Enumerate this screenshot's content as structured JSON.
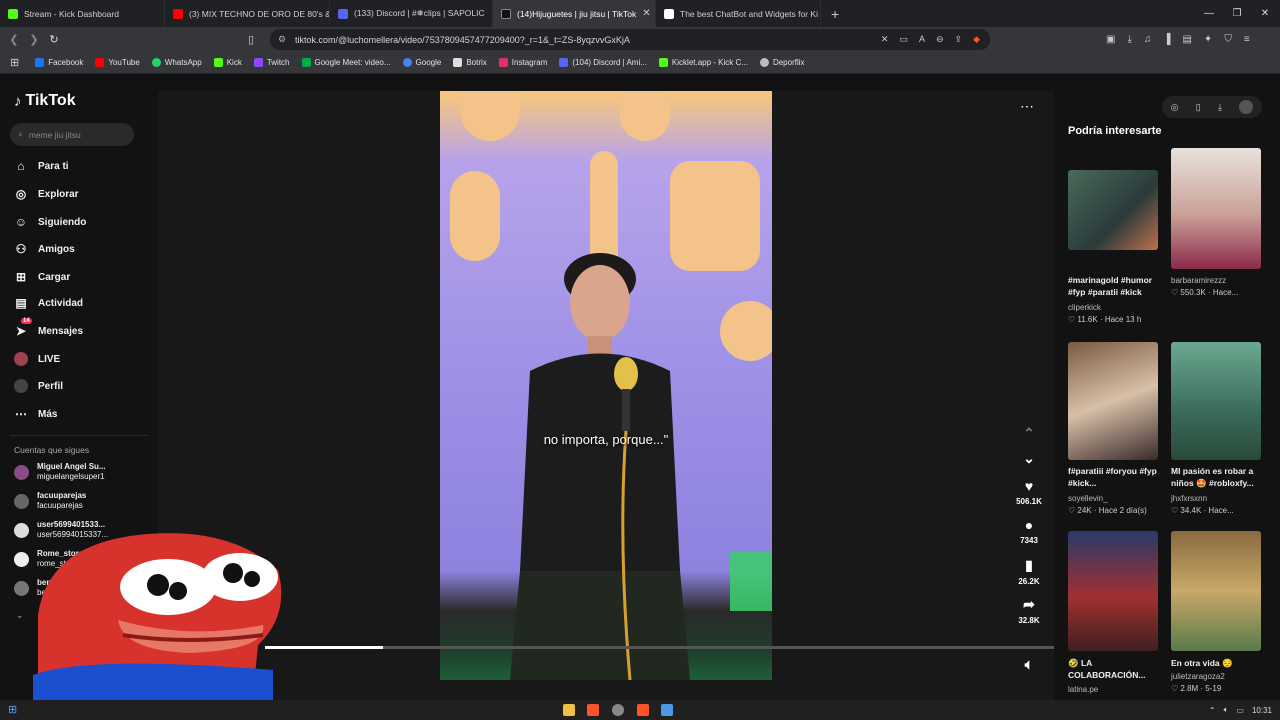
{
  "tabs": [
    {
      "title": "Stream - Kick Dashboard",
      "color": "#53fc18"
    },
    {
      "title": "(3) MIX TECHNO DE ORO DE 80's &",
      "color": "#ff0000"
    },
    {
      "title": "(133) Discord | #❅clips | SAPOLIC",
      "color": "#5865f2"
    },
    {
      "title": "(14)Hijuguetes | jiu jitsu | TikTok",
      "color": "#111111",
      "active": true
    },
    {
      "title": "The best ChatBot and Widgets for Ki",
      "color": "#ffffff"
    }
  ],
  "url": "tiktok.com/@luchomellera/video/7537809457477209400?_r=1&_t=ZS-8yqzvvGxKjA",
  "bookmarks": [
    {
      "label": "Facebook",
      "color": "#1877f2"
    },
    {
      "label": "YouTube",
      "color": "#ff0000"
    },
    {
      "label": "WhatsApp",
      "color": "#25d366"
    },
    {
      "label": "Kick",
      "color": "#53fc18"
    },
    {
      "label": "Twitch",
      "color": "#9146ff"
    },
    {
      "label": "Google Meet: video...",
      "color": "#00ac47"
    },
    {
      "label": "Google",
      "color": "#4285f4"
    },
    {
      "label": "Botrix",
      "color": "#dddddd"
    },
    {
      "label": "Instagram",
      "color": "#e1306c"
    },
    {
      "label": "(104) Discord | Ami...",
      "color": "#5865f2"
    },
    {
      "label": "Kicklet.app - Kick C...",
      "color": "#53fc18"
    },
    {
      "label": "Deporflix",
      "color": "#bbbbbb"
    }
  ],
  "sidebar": {
    "logo": "TikTok",
    "search_placeholder": "meme jiu jitsu",
    "nav": [
      "Para ti",
      "Explorar",
      "Siguiendo",
      "Amigos",
      "Cargar",
      "Actividad",
      "Mensajes",
      "LIVE",
      "Perfil",
      "Más"
    ],
    "messages_badge": "14",
    "following_title": "Cuentas que sigues",
    "accounts": [
      {
        "name": "Miguel Angel Su...",
        "handle": "miguelangelsuper1"
      },
      {
        "name": "facuuparejas",
        "handle": "facuuparejas"
      },
      {
        "name": "user5699401533...",
        "handle": "user56994015337..."
      },
      {
        "name": "Rome_store",
        "handle": "rome_sto..."
      },
      {
        "name": "benv...",
        "handle": "be..."
      }
    ]
  },
  "video": {
    "subtitle": "no importa, porque...\"",
    "likes": "506.1K",
    "comments": "7343",
    "saves": "26.2K",
    "shares": "32.8K",
    "progress": 0.15
  },
  "recommended": {
    "title": "Podría interesarte",
    "items": [
      {
        "title": "#marinagold #humor #fyp #paratii #kick",
        "author": "cliperkick",
        "meta": "11.6K · Hace 13 h"
      },
      {
        "title": "",
        "author": "barbaramirezzz",
        "meta": "550.3K · Hace..."
      },
      {
        "title": "f#paratiii #foryou #fyp #kick...",
        "author": "soyellevin_",
        "meta": "24K · Hace 2 día(s)"
      },
      {
        "title": "MI pasión es robar a niños 🤩 #robloxfy...",
        "author": "jhxfxrsxnn",
        "meta": "34.4K · Hace..."
      },
      {
        "title": "🤣 LA COLABORACIÓN...",
        "author": "latina.pe",
        "meta": ""
      },
      {
        "title": "En otra vida 😔",
        "author": "julietzaragoza2",
        "meta": "2.8M · 5-19"
      }
    ]
  },
  "taskbar": {
    "time": "10:31"
  }
}
